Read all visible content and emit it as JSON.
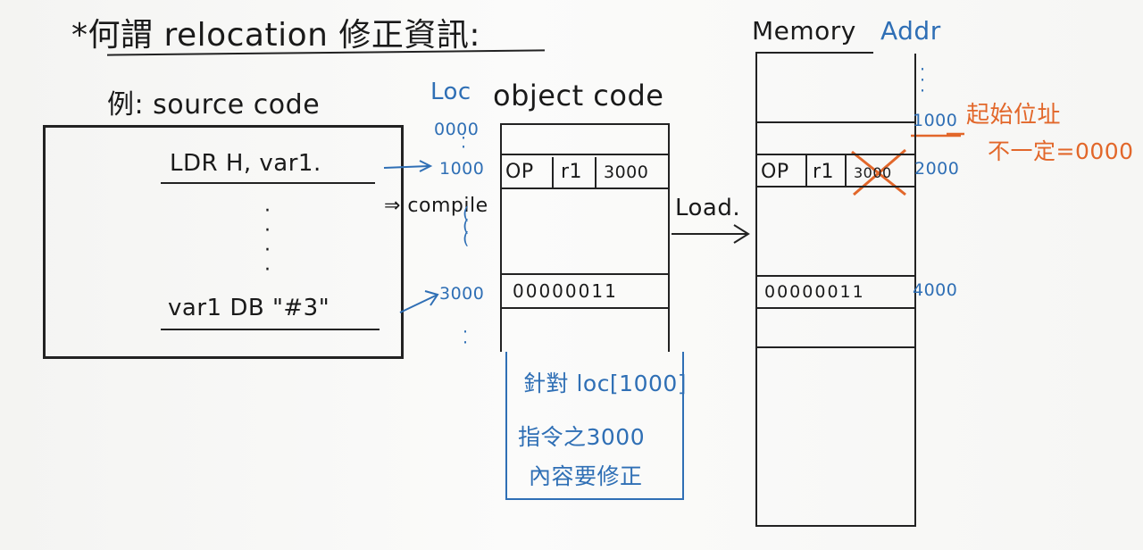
{
  "title": "*何謂 relocation 修正資訊:",
  "example_label": "例: source code",
  "source_code": {
    "line1": "LDR H, var1.",
    "line2": "var1 DB \"#3\""
  },
  "compile_label": "⇒ compile",
  "object_code": {
    "loc_header": "Loc",
    "header": "object code",
    "loc_0000": "0000",
    "loc_1000": "1000",
    "loc_3000": "3000",
    "instr_op": "OP",
    "instr_reg": "r1",
    "instr_addr": "3000",
    "data_value": "00000011"
  },
  "note": {
    "line1": "針對 loc[1000]",
    "line2": "指令之3000",
    "line3": "內容要修正"
  },
  "load_label": "Load.",
  "memory": {
    "header": "Memory",
    "addr_header": "Addr",
    "addr_1000": "1000",
    "addr_2000": "2000",
    "addr_4000": "4000",
    "instr_op": "OP",
    "instr_reg": "r1",
    "instr_addr": "3000",
    "data_value": "00000011"
  },
  "start_addr_note": {
    "line1": "起始位址",
    "line2": "不一定=0000"
  },
  "colors": {
    "ink": "#1a1a1a",
    "blue": "#2f6fb5",
    "orange": "#e2672a"
  }
}
